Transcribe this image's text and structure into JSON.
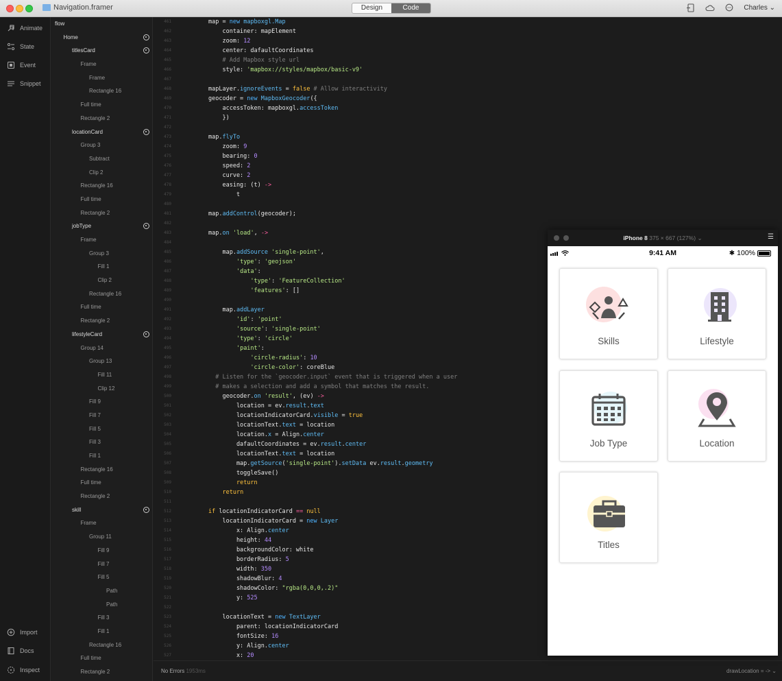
{
  "titlebar": {
    "document_name": "Navigation.framer",
    "mode_tabs": [
      "Design",
      "Code"
    ],
    "active_tab": "Code",
    "user": "Charles",
    "icons": [
      "device-icon",
      "cloud-icon",
      "chat-icon"
    ]
  },
  "leftbar": {
    "top_items": [
      {
        "label": "Animate",
        "icon": "animate-icon"
      },
      {
        "label": "State",
        "icon": "state-icon"
      },
      {
        "label": "Event",
        "icon": "event-icon"
      },
      {
        "label": "Snippet",
        "icon": "snippet-icon"
      }
    ],
    "bottom_items": [
      {
        "label": "Import",
        "icon": "import-icon"
      },
      {
        "label": "Docs",
        "icon": "docs-icon"
      },
      {
        "label": "Inspect",
        "icon": "inspect-icon"
      }
    ]
  },
  "layers": [
    {
      "name": "flow",
      "depth": 0,
      "top": true,
      "target": false
    },
    {
      "name": "Home",
      "depth": 1,
      "top": true,
      "target": true
    },
    {
      "name": "titlesCard",
      "depth": 2,
      "top": true,
      "target": true
    },
    {
      "name": "Frame",
      "depth": 3,
      "top": false,
      "target": false
    },
    {
      "name": "Frame",
      "depth": 4,
      "top": false,
      "target": false
    },
    {
      "name": "Rectangle 16",
      "depth": 4,
      "top": false,
      "target": false
    },
    {
      "name": "Full time",
      "depth": 3,
      "top": false,
      "target": false
    },
    {
      "name": "Rectangle 2",
      "depth": 3,
      "top": false,
      "target": false
    },
    {
      "name": "locationCard",
      "depth": 2,
      "top": true,
      "target": true
    },
    {
      "name": "Group 3",
      "depth": 3,
      "top": false,
      "target": false
    },
    {
      "name": "Subtract",
      "depth": 4,
      "top": false,
      "target": false
    },
    {
      "name": "Clip 2",
      "depth": 4,
      "top": false,
      "target": false
    },
    {
      "name": "Rectangle 16",
      "depth": 3,
      "top": false,
      "target": false
    },
    {
      "name": "Full time",
      "depth": 3,
      "top": false,
      "target": false
    },
    {
      "name": "Rectangle 2",
      "depth": 3,
      "top": false,
      "target": false
    },
    {
      "name": "jobType",
      "depth": 2,
      "top": true,
      "target": true
    },
    {
      "name": "Frame",
      "depth": 3,
      "top": false,
      "target": false
    },
    {
      "name": "Group 3",
      "depth": 4,
      "top": false,
      "target": false
    },
    {
      "name": "Fill 1",
      "depth": 5,
      "top": false,
      "target": false
    },
    {
      "name": "Clip 2",
      "depth": 5,
      "top": false,
      "target": false
    },
    {
      "name": "Rectangle 16",
      "depth": 4,
      "top": false,
      "target": false
    },
    {
      "name": "Full time",
      "depth": 3,
      "top": false,
      "target": false
    },
    {
      "name": "Rectangle 2",
      "depth": 3,
      "top": false,
      "target": false
    },
    {
      "name": "lifestyleCard",
      "depth": 2,
      "top": true,
      "target": true
    },
    {
      "name": "Group 14",
      "depth": 3,
      "top": false,
      "target": false
    },
    {
      "name": "Group 13",
      "depth": 4,
      "top": false,
      "target": false
    },
    {
      "name": "Fill 11",
      "depth": 5,
      "top": false,
      "target": false
    },
    {
      "name": "Clip 12",
      "depth": 5,
      "top": false,
      "target": false
    },
    {
      "name": "Fill 9",
      "depth": 4,
      "top": false,
      "target": false
    },
    {
      "name": "Fill 7",
      "depth": 4,
      "top": false,
      "target": false
    },
    {
      "name": "Fill 5",
      "depth": 4,
      "top": false,
      "target": false
    },
    {
      "name": "Fill 3",
      "depth": 4,
      "top": false,
      "target": false
    },
    {
      "name": "Fill 1",
      "depth": 4,
      "top": false,
      "target": false
    },
    {
      "name": "Rectangle 16",
      "depth": 3,
      "top": false,
      "target": false
    },
    {
      "name": "Full time",
      "depth": 3,
      "top": false,
      "target": false
    },
    {
      "name": "Rectangle 2",
      "depth": 3,
      "top": false,
      "target": false
    },
    {
      "name": "skill",
      "depth": 2,
      "top": true,
      "target": true
    },
    {
      "name": "Frame",
      "depth": 3,
      "top": false,
      "target": false
    },
    {
      "name": "Group 11",
      "depth": 4,
      "top": false,
      "target": false
    },
    {
      "name": "Fill 9",
      "depth": 5,
      "top": false,
      "target": false
    },
    {
      "name": "Fill 7",
      "depth": 5,
      "top": false,
      "target": false
    },
    {
      "name": "Fill 5",
      "depth": 5,
      "top": false,
      "target": false
    },
    {
      "name": "Path",
      "depth": 6,
      "top": false,
      "target": false
    },
    {
      "name": "Path",
      "depth": 6,
      "top": false,
      "target": false
    },
    {
      "name": "Fill 3",
      "depth": 5,
      "top": false,
      "target": false
    },
    {
      "name": "Fill 1",
      "depth": 5,
      "top": false,
      "target": false
    },
    {
      "name": "Rectangle 16",
      "depth": 4,
      "top": false,
      "target": false
    },
    {
      "name": "Full time",
      "depth": 3,
      "top": false,
      "target": false
    },
    {
      "name": "Rectangle 2",
      "depth": 3,
      "top": false,
      "target": false
    }
  ],
  "editor": {
    "first_line_number": 461,
    "lines": [
      [
        [
          "map = ",
          "t"
        ],
        [
          "new ",
          "k"
        ],
        [
          "mapboxgl.Map",
          "f"
        ]
      ],
      [
        [
          "    container: mapElement",
          "t"
        ]
      ],
      [
        [
          "    zoom: ",
          "t"
        ],
        [
          "12",
          "n"
        ]
      ],
      [
        [
          "    center: dafaultCoordinates",
          "t"
        ]
      ],
      [
        [
          "    # Add Mapbox style url",
          "c"
        ]
      ],
      [
        [
          "    style: ",
          "t"
        ],
        [
          "'mapbox://styles/mapbox/basic-v9'",
          "s"
        ]
      ],
      [
        [
          "",
          "t"
        ]
      ],
      [
        [
          "mapLayer.",
          "t"
        ],
        [
          "ignoreEvents",
          "f"
        ],
        [
          " = ",
          "t"
        ],
        [
          "false",
          "k2"
        ],
        [
          " # Allow interactivity",
          "c"
        ]
      ],
      [
        [
          "geocoder = ",
          "t"
        ],
        [
          "new ",
          "k"
        ],
        [
          "MapboxGeocoder",
          "f"
        ],
        [
          "({",
          "t"
        ]
      ],
      [
        [
          "    accessToken: mapboxgl.",
          "t"
        ],
        [
          "accessToken",
          "f"
        ]
      ],
      [
        [
          "    })",
          "t"
        ]
      ],
      [
        [
          "",
          "t"
        ]
      ],
      [
        [
          "map.",
          "t"
        ],
        [
          "flyTo",
          "f"
        ]
      ],
      [
        [
          "    zoom: ",
          "t"
        ],
        [
          "9",
          "n"
        ]
      ],
      [
        [
          "    bearing: ",
          "t"
        ],
        [
          "0",
          "n"
        ]
      ],
      [
        [
          "    speed: ",
          "t"
        ],
        [
          "2",
          "n"
        ]
      ],
      [
        [
          "    curve: ",
          "t"
        ],
        [
          "2",
          "n"
        ]
      ],
      [
        [
          "    easing: (t) ",
          "t"
        ],
        [
          "->",
          "p"
        ]
      ],
      [
        [
          "        t",
          "t"
        ]
      ],
      [
        [
          "",
          "t"
        ]
      ],
      [
        [
          "map.",
          "t"
        ],
        [
          "addControl",
          "f"
        ],
        [
          "(geocoder);",
          "t"
        ]
      ],
      [
        [
          "",
          "t"
        ]
      ],
      [
        [
          "map.",
          "t"
        ],
        [
          "on",
          "f"
        ],
        [
          " ",
          "t"
        ],
        [
          "'load'",
          "s"
        ],
        [
          ", ",
          "t"
        ],
        [
          "->",
          "p"
        ]
      ],
      [
        [
          "",
          "t"
        ]
      ],
      [
        [
          "    map.",
          "t"
        ],
        [
          "addSource",
          "f"
        ],
        [
          " ",
          "t"
        ],
        [
          "'single-point'",
          "s"
        ],
        [
          ",",
          "t"
        ]
      ],
      [
        [
          "        ",
          "t"
        ],
        [
          "'type'",
          "s"
        ],
        [
          ": ",
          "t"
        ],
        [
          "'geojson'",
          "s"
        ]
      ],
      [
        [
          "        ",
          "t"
        ],
        [
          "'data'",
          "s"
        ],
        [
          ":",
          "t"
        ]
      ],
      [
        [
          "            ",
          "t"
        ],
        [
          "'type'",
          "s"
        ],
        [
          ": ",
          "t"
        ],
        [
          "'FeatureCollection'",
          "s"
        ]
      ],
      [
        [
          "            ",
          "t"
        ],
        [
          "'features'",
          "s"
        ],
        [
          ": []",
          "t"
        ]
      ],
      [
        [
          "",
          "t"
        ]
      ],
      [
        [
          "    map.",
          "t"
        ],
        [
          "addLayer",
          "f"
        ]
      ],
      [
        [
          "        ",
          "t"
        ],
        [
          "'id'",
          "s"
        ],
        [
          ": ",
          "t"
        ],
        [
          "'point'",
          "s"
        ]
      ],
      [
        [
          "        ",
          "t"
        ],
        [
          "'source'",
          "s"
        ],
        [
          ": ",
          "t"
        ],
        [
          "'single-point'",
          "s"
        ]
      ],
      [
        [
          "        ",
          "t"
        ],
        [
          "'type'",
          "s"
        ],
        [
          ": ",
          "t"
        ],
        [
          "'circle'",
          "s"
        ]
      ],
      [
        [
          "        ",
          "t"
        ],
        [
          "'paint'",
          "s"
        ],
        [
          ":",
          "t"
        ]
      ],
      [
        [
          "            ",
          "t"
        ],
        [
          "'circle-radius'",
          "s"
        ],
        [
          ": ",
          "t"
        ],
        [
          "10",
          "n"
        ]
      ],
      [
        [
          "            ",
          "t"
        ],
        [
          "'circle-color'",
          "s"
        ],
        [
          ": coreBlue",
          "t"
        ]
      ],
      [
        [
          "  # Listen for the `geocoder.input` event that is triggered when a user",
          "c"
        ]
      ],
      [
        [
          "  # makes a selection and add a symbol that matches the result.",
          "c"
        ]
      ],
      [
        [
          "    geocoder.",
          "t"
        ],
        [
          "on",
          "f"
        ],
        [
          " ",
          "t"
        ],
        [
          "'result'",
          "s"
        ],
        [
          ", (ev) ",
          "t"
        ],
        [
          "->",
          "p"
        ]
      ],
      [
        [
          "        location = ev.",
          "t"
        ],
        [
          "result",
          "f"
        ],
        [
          ".",
          "t"
        ],
        [
          "text",
          "f"
        ]
      ],
      [
        [
          "        locationIndicatorCard.",
          "t"
        ],
        [
          "visible",
          "f"
        ],
        [
          " = ",
          "t"
        ],
        [
          "true",
          "k2"
        ]
      ],
      [
        [
          "        locationText.",
          "t"
        ],
        [
          "text",
          "f"
        ],
        [
          " = location",
          "t"
        ]
      ],
      [
        [
          "        location.",
          "t"
        ],
        [
          "x",
          "f"
        ],
        [
          " = Align.",
          "t"
        ],
        [
          "center",
          "f"
        ]
      ],
      [
        [
          "        dafaultCoordinates = ev.",
          "t"
        ],
        [
          "result",
          "f"
        ],
        [
          ".",
          "t"
        ],
        [
          "center",
          "f"
        ]
      ],
      [
        [
          "        locationText.",
          "t"
        ],
        [
          "text",
          "f"
        ],
        [
          " = location",
          "t"
        ]
      ],
      [
        [
          "        map.",
          "t"
        ],
        [
          "getSource",
          "f"
        ],
        [
          "(",
          "t"
        ],
        [
          "'single-point'",
          "s"
        ],
        [
          ").",
          "t"
        ],
        [
          "setData",
          "f"
        ],
        [
          " ev.",
          "t"
        ],
        [
          "result",
          "f"
        ],
        [
          ".",
          "t"
        ],
        [
          "geometry",
          "f"
        ]
      ],
      [
        [
          "        toggleSave()",
          "t"
        ]
      ],
      [
        [
          "        ",
          "t"
        ],
        [
          "return",
          "k2"
        ]
      ],
      [
        [
          "    ",
          "t"
        ],
        [
          "return",
          "k2"
        ]
      ],
      [
        [
          "",
          "t"
        ]
      ],
      [
        [
          "if",
          "k2"
        ],
        [
          " locationIndicatorCard ",
          "t"
        ],
        [
          "==",
          "p"
        ],
        [
          " ",
          "t"
        ],
        [
          "null",
          "k2"
        ]
      ],
      [
        [
          "    locationIndicatorCard = ",
          "t"
        ],
        [
          "new ",
          "k"
        ],
        [
          "Layer",
          "f"
        ]
      ],
      [
        [
          "        x: Align.",
          "t"
        ],
        [
          "center",
          "f"
        ]
      ],
      [
        [
          "        height: ",
          "t"
        ],
        [
          "44",
          "n"
        ]
      ],
      [
        [
          "        backgroundColor: white",
          "t"
        ]
      ],
      [
        [
          "        borderRadius: ",
          "t"
        ],
        [
          "5",
          "n"
        ]
      ],
      [
        [
          "        width: ",
          "t"
        ],
        [
          "350",
          "n"
        ]
      ],
      [
        [
          "        shadowBlur: ",
          "t"
        ],
        [
          "4",
          "n"
        ]
      ],
      [
        [
          "        shadowColor: ",
          "t"
        ],
        [
          "\"rgba(0,0,0,.2)\"",
          "s"
        ]
      ],
      [
        [
          "        y: ",
          "t"
        ],
        [
          "525",
          "n"
        ]
      ],
      [
        [
          "",
          "t"
        ]
      ],
      [
        [
          "    locationText = ",
          "t"
        ],
        [
          "new ",
          "k"
        ],
        [
          "TextLayer",
          "f"
        ]
      ],
      [
        [
          "        parent: locationIndicatorCard",
          "t"
        ]
      ],
      [
        [
          "        fontSize: ",
          "t"
        ],
        [
          "16",
          "n"
        ]
      ],
      [
        [
          "        y: Align.",
          "t"
        ],
        [
          "center",
          "f"
        ]
      ],
      [
        [
          "        x: ",
          "t"
        ],
        [
          "20",
          "n"
        ]
      ]
    ],
    "colors": {
      "t": "#e6e6e6",
      "k": "#4fb3ff",
      "k2": "#ffc23d",
      "f": "#5fbcf5",
      "n": "#b58cff",
      "s": "#b8e986",
      "c": "#7f7f7f",
      "p": "#ff5fa0"
    }
  },
  "status": {
    "errors": "No Errors",
    "time": "1953ms",
    "right": "drawLocation = ->"
  },
  "preview": {
    "device": "iPhone 8",
    "resolution": "375 × 667 (127%)",
    "phone_time": "9:41 AM",
    "battery": "100%",
    "battery_level": 1.0,
    "cards": [
      {
        "label": "Skills",
        "icon": "skills-icon",
        "accent": "#fde0e0"
      },
      {
        "label": "Lifestyle",
        "icon": "building-icon",
        "accent": "#ece6fb"
      },
      {
        "label": "Job Type",
        "icon": "calendar-icon",
        "accent": "#e6f6fa"
      },
      {
        "label": "Location",
        "icon": "location-pin-icon",
        "accent": "#fbe0f0"
      },
      {
        "label": "Titles",
        "icon": "briefcase-icon",
        "accent": "#fff4cf"
      }
    ]
  }
}
